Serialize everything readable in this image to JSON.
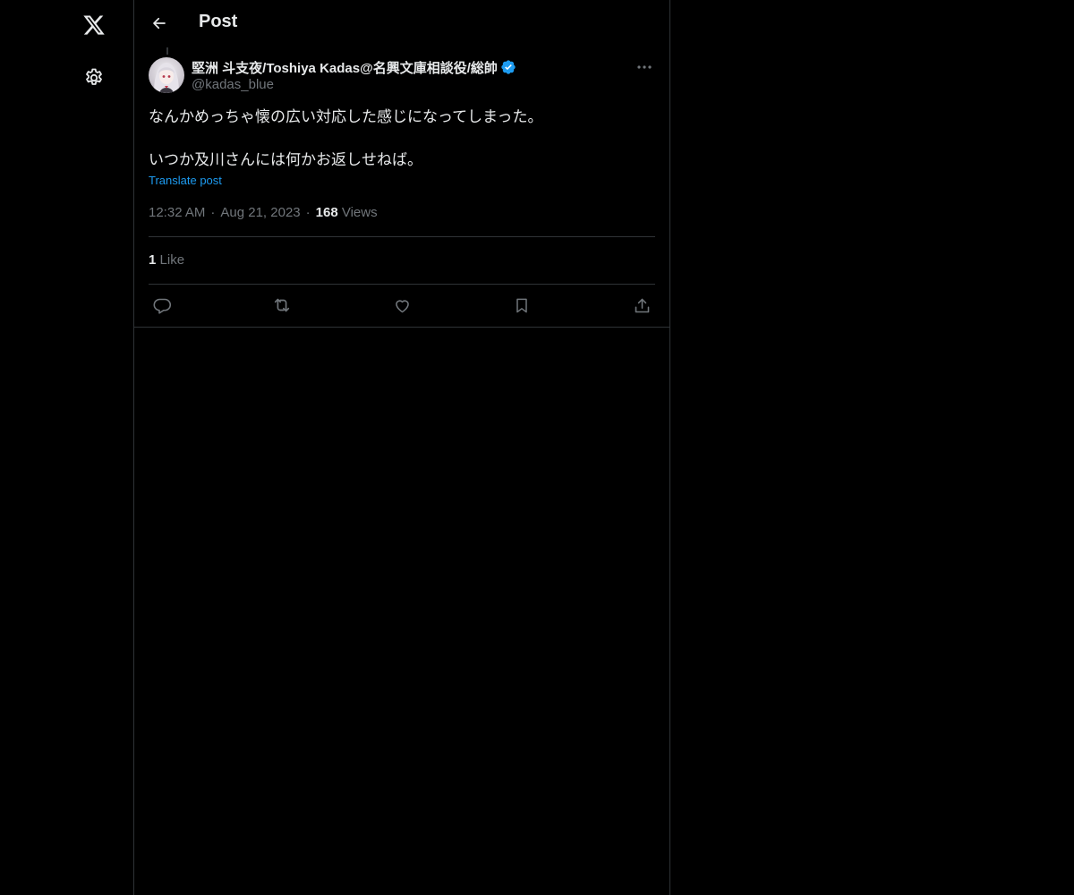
{
  "nav": {
    "logo_icon": "x-logo-icon",
    "settings_icon": "gear-icon"
  },
  "header": {
    "back_icon": "arrow-left-icon",
    "title": "Post"
  },
  "post": {
    "display_name": "堅洲 斗支夜/Toshiya Kadas@名興文庫相談役/総帥",
    "verified_icon": "verified-badge-icon",
    "handle": "@kadas_blue",
    "more_icon": "more-horizontal-icon",
    "text_line1": "なんかめっちゃ懐の広い対応した感じになってしまった。",
    "text_line2": "いつか及川さんには何かお返しせねば。",
    "translate_label": "Translate post",
    "time": "12:32 AM",
    "separator": "·",
    "date": "Aug 21, 2023",
    "views_count": "168",
    "views_label": "Views",
    "likes_count": "1",
    "likes_label": "Like"
  },
  "actions": {
    "reply_icon": "reply-icon",
    "repost_icon": "repost-icon",
    "like_icon": "heart-icon",
    "bookmark_icon": "bookmark-icon",
    "share_icon": "share-icon"
  },
  "colors": {
    "background": "#000000",
    "text": "#e7e9ea",
    "secondary_text": "#71767b",
    "border": "#2f3336",
    "accent": "#1d9bf0"
  }
}
